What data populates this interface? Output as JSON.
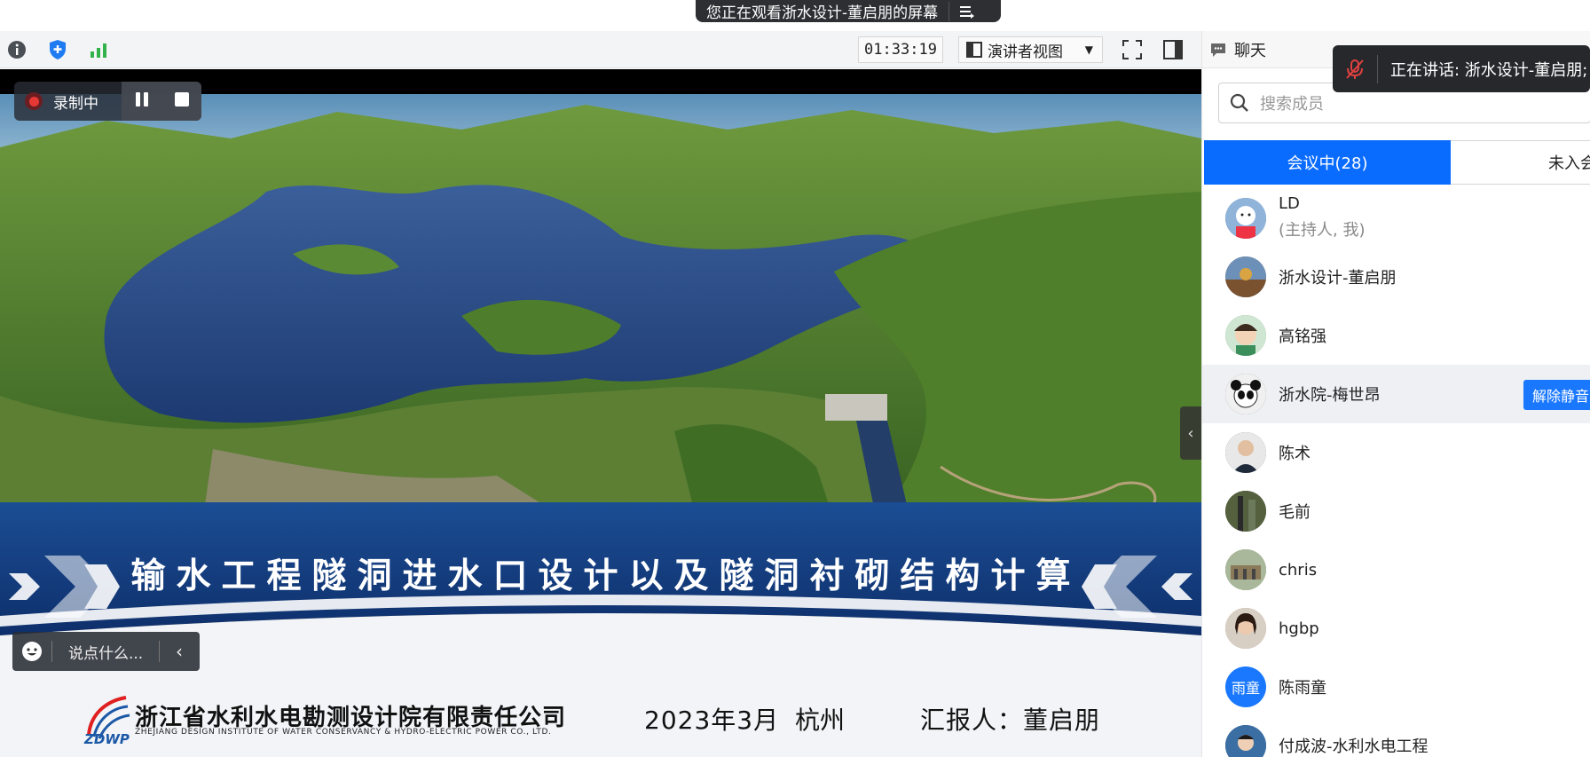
{
  "banner": {
    "text": "您正在观看浙水设计-董启朋的屏幕",
    "menu_icon": "list-icon"
  },
  "toolbar": {
    "icons": [
      "info-icon",
      "shield-icon",
      "signal-icon"
    ],
    "timer": "01:33:19",
    "view_label": "演讲者视图",
    "view_icon": "speaker-view-icon",
    "fullscreen_icon": "fullscreen-icon",
    "sidebar_icon": "sidebar-toggle-icon"
  },
  "recording": {
    "label": "录制中"
  },
  "reaction": {
    "placeholder": "说点什么..."
  },
  "slide": {
    "title": "输水工程隧洞进水口设计以及隧洞衬砌结构计算",
    "company_cn": "浙江省水利水电勘测设计院有限责任公司",
    "company_en": "ZHEJIANG DESIGN INSTITUTE OF WATER CONSERVANCY & HYDRO-ELECTRIC POWER CO., LTD.",
    "logo_text": "ZDWP",
    "date": "2023年3月",
    "city": "杭州",
    "reporter": "汇报人：董启朋"
  },
  "panel": {
    "chat_tab": "聊天",
    "speaking": "正在讲话: 浙水设计-董启朋;",
    "search_placeholder": "搜索成员",
    "tab_in_meeting": "会议中(28)",
    "tab_not_joined": "未入会",
    "unmute_label": "解除静音",
    "participants": [
      {
        "name": "LD",
        "sub": "(主持人, 我)",
        "color": "#5a7fb5"
      },
      {
        "name": "浙水设计-董启朋",
        "sub": "",
        "color": "#8c6a3a"
      },
      {
        "name": "高铭强",
        "sub": "",
        "color": "#5e8d6b"
      },
      {
        "name": "浙水院-梅世昂",
        "sub": "",
        "color": "#444444"
      },
      {
        "name": "陈术",
        "sub": "",
        "color": "#3a4a5e"
      },
      {
        "name": "毛前",
        "sub": "",
        "color": "#4d5a3a"
      },
      {
        "name": "chris",
        "sub": "",
        "color": "#7a8a6a"
      },
      {
        "name": "hgbp",
        "sub": "",
        "color": "#9a7a6a"
      },
      {
        "name": "陈雨童",
        "sub": "",
        "color": "#1a78ff",
        "initials": "雨童"
      },
      {
        "name": "付成波-水利水电工程",
        "sub": "",
        "color": "#2a5a8a"
      }
    ]
  }
}
